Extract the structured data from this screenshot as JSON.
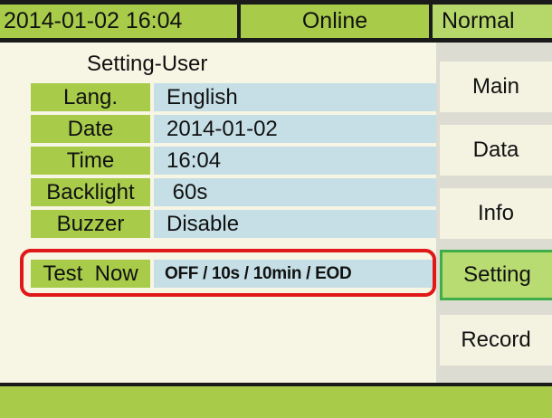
{
  "topbar": {
    "datetime": "2014-01-02 16:04",
    "status": "Online",
    "mode": "Normal"
  },
  "panel": {
    "title": "Setting-User",
    "rows": [
      {
        "label": "Lang.",
        "value": "English"
      },
      {
        "label": "Date",
        "value": "2014-01-02"
      },
      {
        "label": "Time",
        "value": "16:04"
      },
      {
        "label": "Backlight",
        "value": " 60s"
      },
      {
        "label": "Buzzer",
        "value": "Disable"
      },
      {
        "label": "Test  Now",
        "value": "OFF / 10s / 10min / EOD"
      }
    ]
  },
  "nav": {
    "items": [
      {
        "label": "Main"
      },
      {
        "label": "Data"
      },
      {
        "label": "Info"
      },
      {
        "label": "Setting"
      },
      {
        "label": "Record"
      }
    ],
    "active": "Setting"
  },
  "colors": {
    "accent_green": "#a8cc4a",
    "value_blue": "#c6dfe6",
    "highlight_red": "#e01818"
  }
}
